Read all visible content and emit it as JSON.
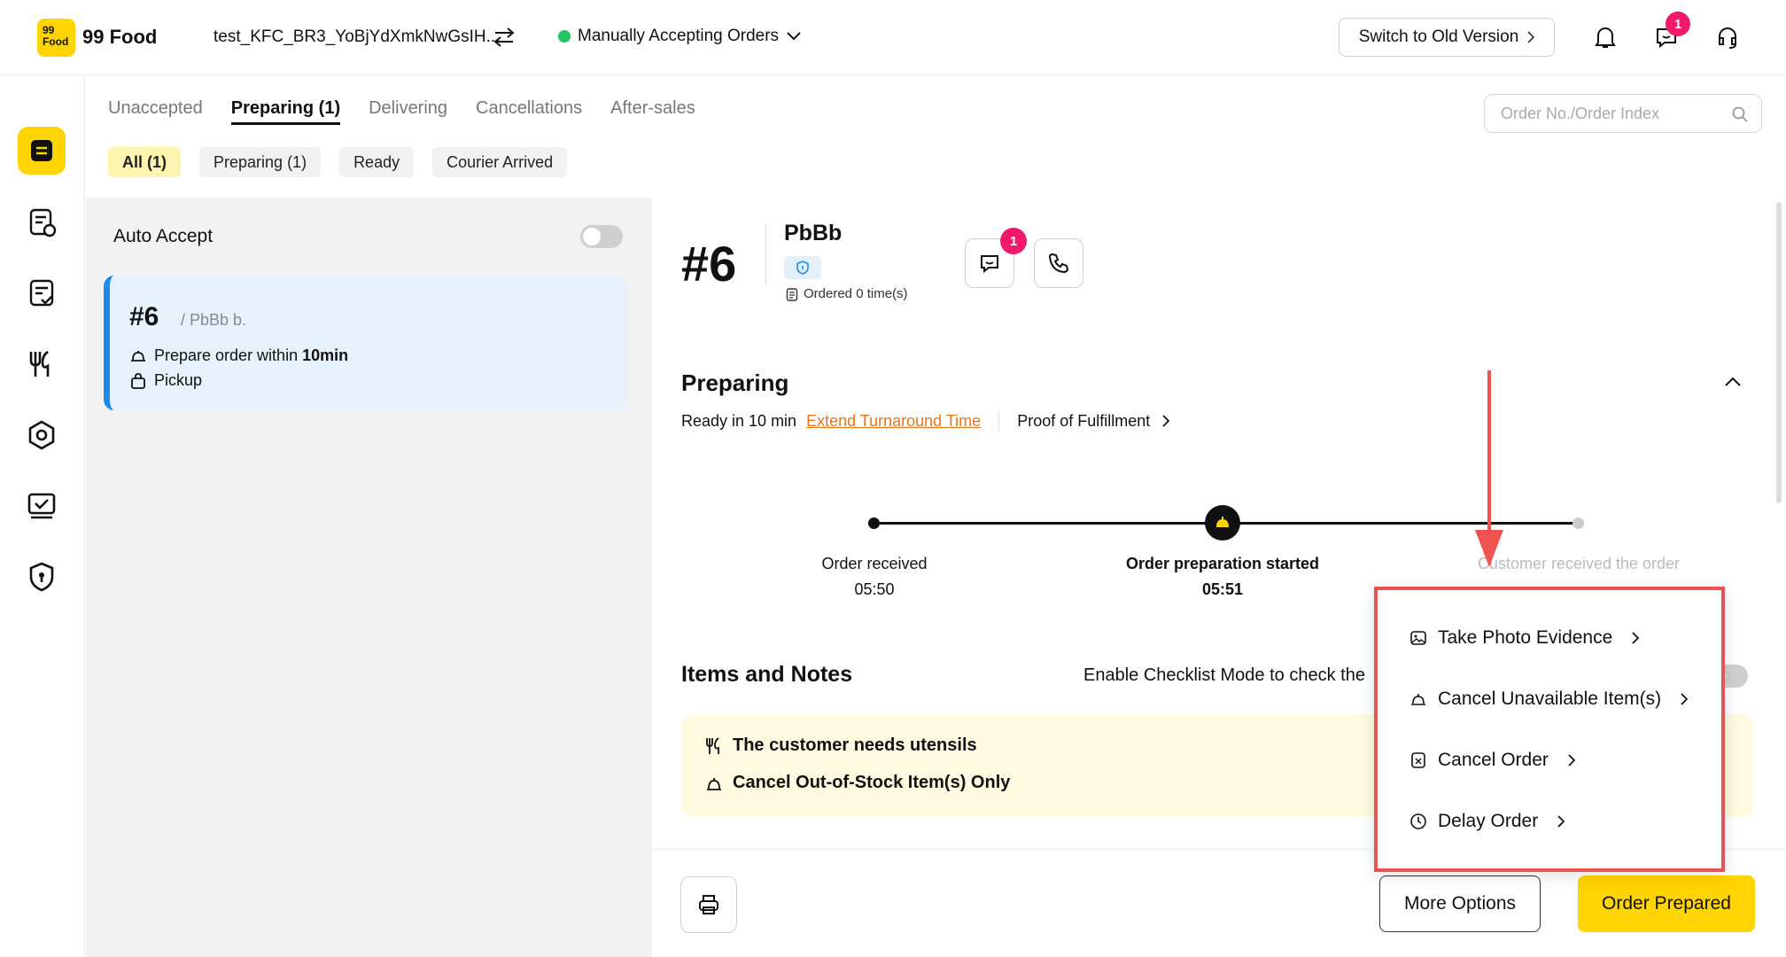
{
  "brand": {
    "logo_small": "99\nFood",
    "name": "99 Food",
    "accent": "#FFD400"
  },
  "header": {
    "store_name": "test_KFC_BR3_YoBjYdXmkNwGsIH...",
    "accept_status": "Manually Accepting Orders",
    "switch_label": "Switch to Old Version",
    "message_badge": "1"
  },
  "sidebar": {
    "items": [
      "orders-icon",
      "order-history-icon",
      "checklist-icon",
      "menu-icon",
      "settings-icon",
      "monitor-icon",
      "security-icon"
    ]
  },
  "tabs": [
    "Unaccepted",
    "Preparing (1)",
    "Delivering",
    "Cancellations",
    "After-sales"
  ],
  "search": {
    "placeholder": "Order No./Order Index"
  },
  "filters": [
    "All (1)",
    "Preparing (1)",
    "Ready",
    "Courier Arrived"
  ],
  "list": {
    "auto_accept_label": "Auto Accept",
    "order": {
      "number": "#6",
      "customer": "/ PbBb b.",
      "prepare_prefix": "Prepare order within ",
      "prepare_time": "10min",
      "type": "Pickup"
    }
  },
  "detail": {
    "number": "#6",
    "customer_name": "PbBb",
    "ordered_count": "Ordered 0 time(s)",
    "chat_badge": "1",
    "status_title": "Preparing",
    "ready_in": "Ready in 10 min",
    "extend_link": "Extend Turnaround Time",
    "proof_link": "Proof of Fulfillment",
    "timeline": [
      {
        "label": "Order received",
        "time": "05:50"
      },
      {
        "label": "Order preparation started",
        "time": "05:51"
      },
      {
        "label": "Customer received the order",
        "time": ""
      }
    ],
    "items_title": "Items and Notes",
    "checklist_text": "Enable Checklist Mode to check the",
    "notes": [
      "The customer needs utensils",
      "Cancel Out-of-Stock Item(s) Only"
    ]
  },
  "menu": {
    "items": [
      "Take Photo Evidence",
      "Cancel Unavailable Item(s)",
      "Cancel Order",
      "Delay Order"
    ]
  },
  "actions": {
    "more_options": "More Options",
    "order_prepared": "Order Prepared"
  }
}
